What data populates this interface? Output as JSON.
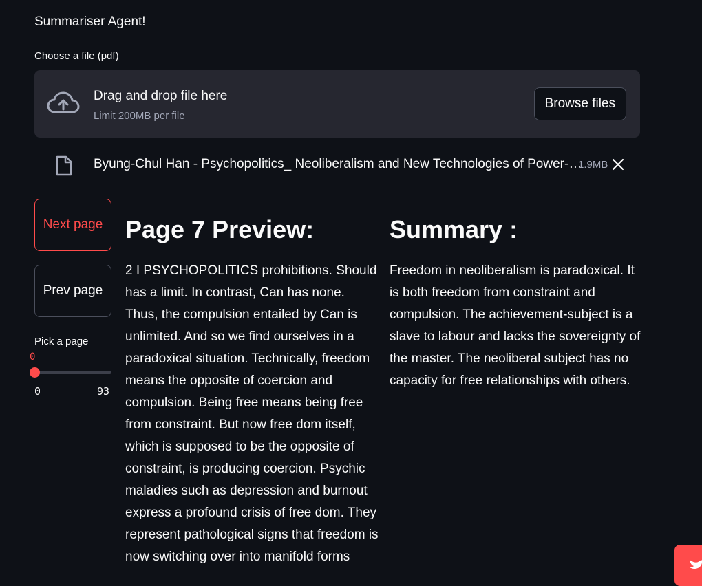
{
  "app": {
    "title": "Summariser Agent!"
  },
  "uploader": {
    "label": "Choose a file (pdf)",
    "drop_title": "Drag and drop file here",
    "limit": "Limit 200MB per file",
    "browse_label": "Browse files",
    "icon": "cloud-upload-icon"
  },
  "uploaded_file": {
    "name": "Byung-Chul Han - Psychopolitics_ Neoliberalism and New Technologies of Power-…",
    "size": "1.9MB",
    "icon": "file-icon"
  },
  "controls": {
    "next_label": "Next page",
    "prev_label": "Prev page",
    "slider_label": "Pick a page",
    "slider_value": "0",
    "slider_min": "0",
    "slider_max": "93"
  },
  "preview": {
    "heading": "Page 7 Preview:",
    "text": "2 I PSYCHOPOLITICS prohibitions. Should has a limit. In contrast, Can has none. Thus, the compulsion entailed by Can is unlimited. And so we find ourselves in a paradoxical situation. Technically, freedom means the opposite of coercion and compulsion. Being free means being free from constraint. But now free dom itself, which is supposed to be the opposite of constraint, is producing coercion. Psychic maladies such as depression and burnout express a profound crisis of free dom. They represent pathological signs that freedom is now switching over into manifold forms"
  },
  "summary": {
    "heading": "Summary :",
    "text": "Freedom in neoliberalism is paradoxical. It is both freedom from constraint and compulsion. The achievement-subject is a slave to labour and lacks the sovereignty of the master. The neoliberal subject has no capacity for free relationships with others."
  },
  "colors": {
    "background": "#0e1117",
    "surface": "#262730",
    "accent": "#ff4b4b",
    "text": "#fafafa",
    "muted": "#a3a8b8"
  }
}
